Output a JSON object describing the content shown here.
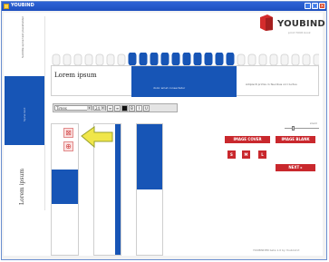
{
  "window": {
    "title": "YOUBIND",
    "buttons": [
      "_",
      "□",
      "×"
    ]
  },
  "brand": {
    "name": "YOUBIND",
    "tagline": "print YOUR book"
  },
  "spine": {
    "top_label": "Subtitle spine text placeholder",
    "mid_label": "Spine text",
    "bottom_label": "Lorem ipsum"
  },
  "banner": {
    "title": "Lorem ipsum",
    "blue_caption": "dolor amet consectetur",
    "side_caption": "Adipiscit primis in faucibus orci luctus"
  },
  "toolbar": {
    "font": "Times",
    "size": "24",
    "bold": "B",
    "italic": "I",
    "underline": "U"
  },
  "zoom": {
    "label": "zoom",
    "value": 0.25
  },
  "actions": {
    "image_cover": "IMAGE COVER",
    "image_blank": "IMAGE BLANK",
    "size_s": "S",
    "size_m": "M",
    "size_l": "L",
    "next": "NEXT"
  },
  "footer": {
    "text": "YOUBINDER beta 1.0 by Youbind.it"
  },
  "colors": {
    "accent_blue": "#1755b6",
    "action_red": "#c9282d",
    "arrow_yellow": "#f0e64a"
  }
}
